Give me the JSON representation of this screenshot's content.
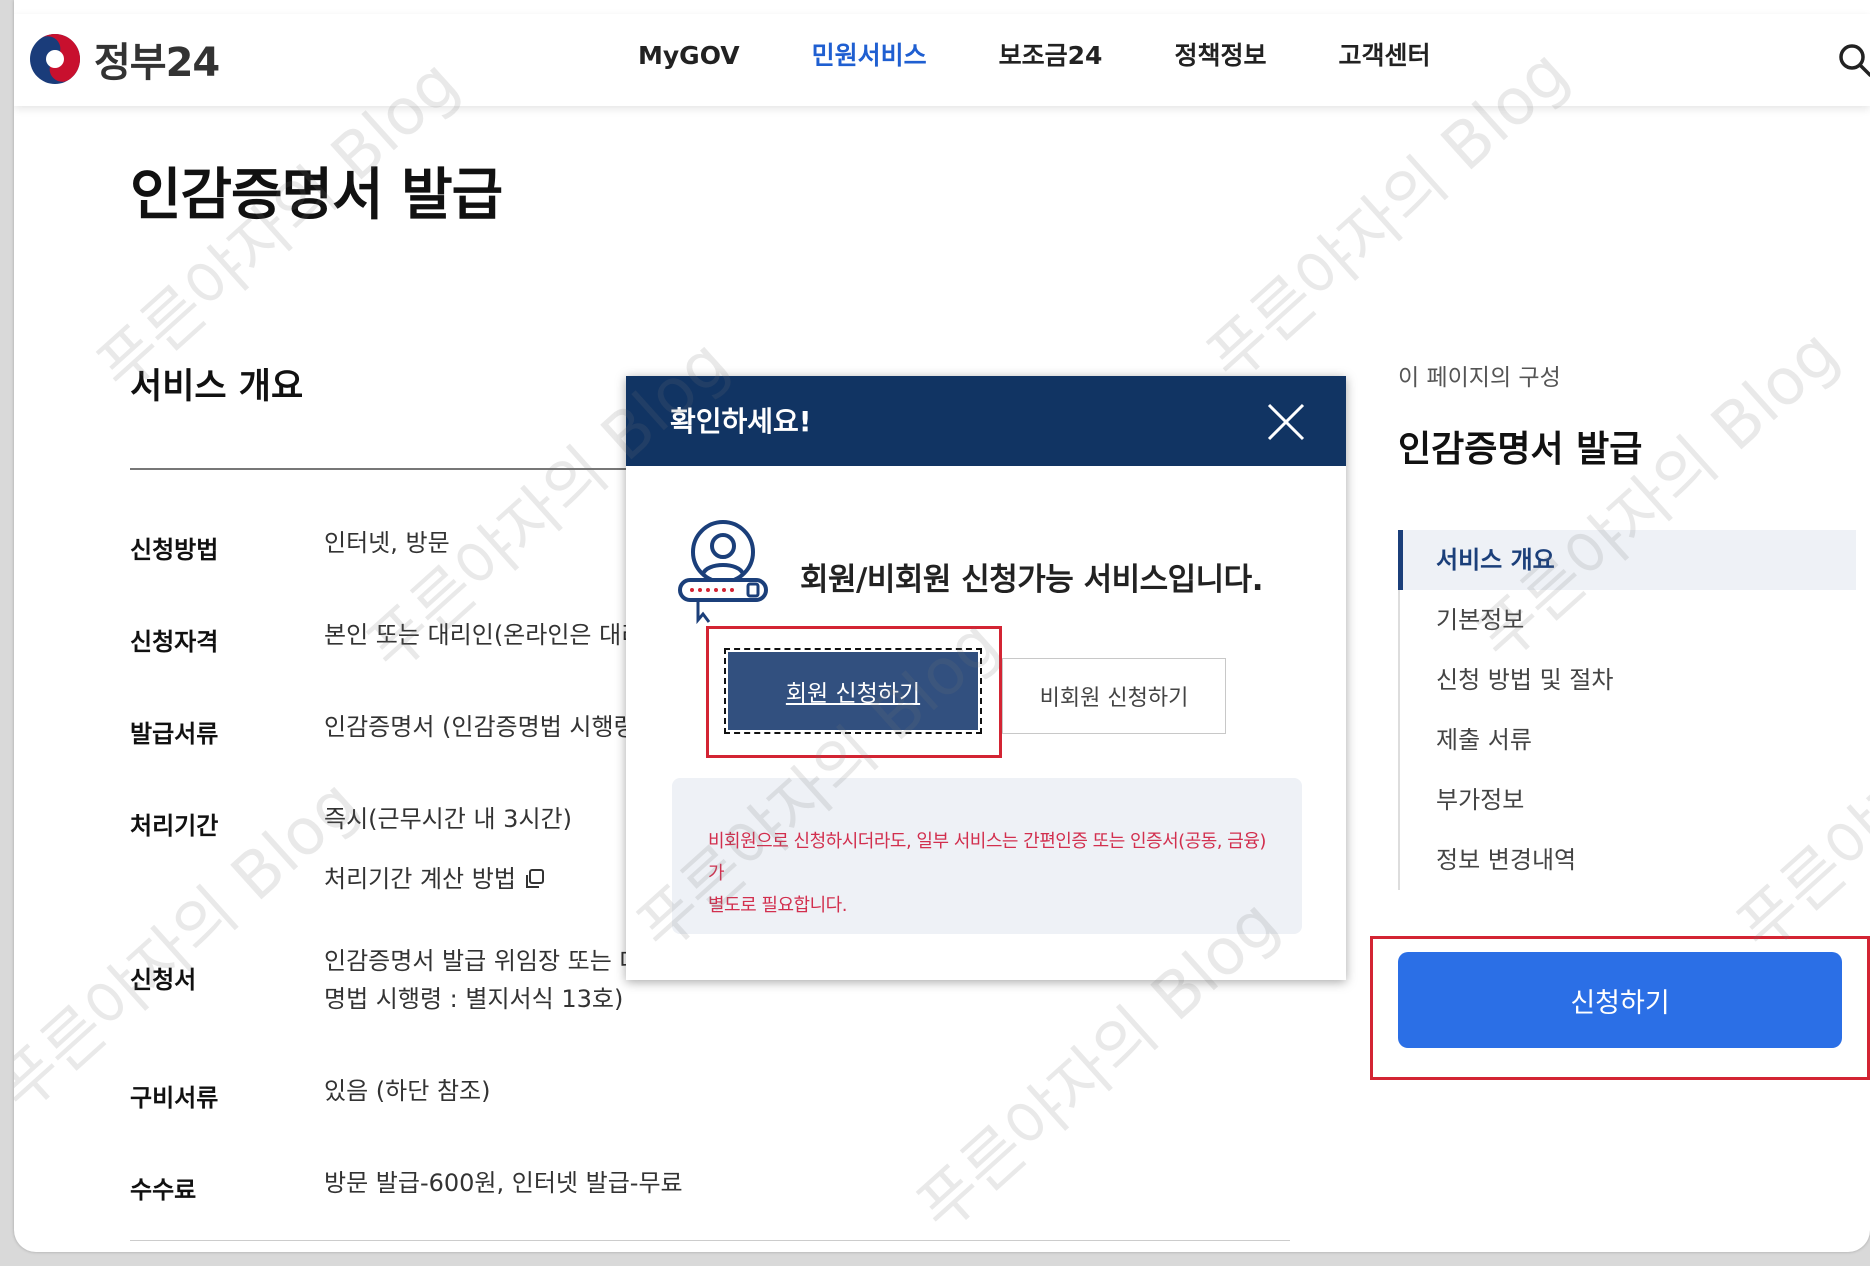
{
  "header": {
    "logo_text": "정부24",
    "nav": [
      {
        "label": "MyGOV"
      },
      {
        "label": "민원서비스"
      },
      {
        "label": "보조금24"
      },
      {
        "label": "정책정보"
      },
      {
        "label": "고객센터"
      }
    ],
    "active_nav": "민원서비스"
  },
  "page": {
    "title": "인감증명서 발급",
    "section_title": "서비스 개요",
    "rows": [
      {
        "label": "신청방법",
        "value": "인터넷, 방문"
      },
      {
        "label": "신청자격",
        "value": "본인 또는 대리인(온라인은 대리"
      },
      {
        "label": "발급서류",
        "value": "인감증명서 (인감증명법 시행령"
      },
      {
        "label": "처리기간",
        "value": "즉시(근무시간 내 3시간)",
        "extra": "처리기간 계산 방법"
      },
      {
        "label": "신청서",
        "value": "인감증명서 발급 위임장 또는 대",
        "value2": "명법 시행령 : 별지서식 13호)"
      },
      {
        "label": "구비서류",
        "value": "있음 (하단 참조)"
      },
      {
        "label": "수수료",
        "value": "방문 발급-600원, 인터넷 발급-무료"
      }
    ]
  },
  "toc": {
    "caption": "이 페이지의 구성",
    "title": "인감증명서 발급",
    "items": [
      {
        "label": "서비스 개요",
        "active": true
      },
      {
        "label": "기본정보"
      },
      {
        "label": "신청 방법 및 절차"
      },
      {
        "label": "제출 서류"
      },
      {
        "label": "부가정보"
      },
      {
        "label": "정보 변경내역"
      }
    ],
    "apply_label": "신청하기"
  },
  "modal": {
    "title": "확인하세요!",
    "message": "회원/비회원 신청가능 서비스입니다.",
    "member_button": "회원 신청하기",
    "guest_button": "비회원 신청하기",
    "notice_line1": "비회원으로 신청하시더라도, 일부 서비스는 간편인증 또는 인증서(공동, 금융)가",
    "notice_line2": "별도로 필요합니다."
  },
  "watermark": "푸른야자의 Blog",
  "colors": {
    "brand_navy": "#113463",
    "active_nav": "#1f5fd1",
    "apply_blue": "#2b6fe6",
    "highlight_red": "#d32433",
    "notice_red": "#d22f4e"
  }
}
